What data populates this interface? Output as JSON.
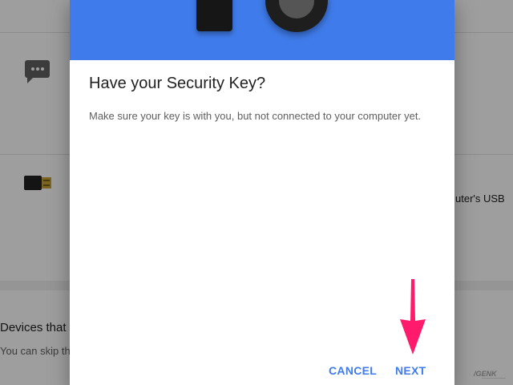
{
  "background": {
    "usb_text": "uter's USB",
    "devices_title": "Devices that",
    "devices_subtitle": "You can skip th"
  },
  "dialog": {
    "title": "Have your Security Key?",
    "body": "Make sure your key is with you, but not connected to your computer yet.",
    "cancel_label": "CANCEL",
    "next_label": "NEXT"
  },
  "watermark": {
    "logo_text": "GENK"
  },
  "colors": {
    "accent": "#3f7bea",
    "annotation_arrow": "#ff1a6b"
  },
  "icons": {
    "background_message": "message-icon",
    "background_usb": "usb-key-icon",
    "header_key_fob": "security-key-fob-icon",
    "header_key_disc": "security-key-disc-icon",
    "annotation": "arrow-down-icon"
  }
}
